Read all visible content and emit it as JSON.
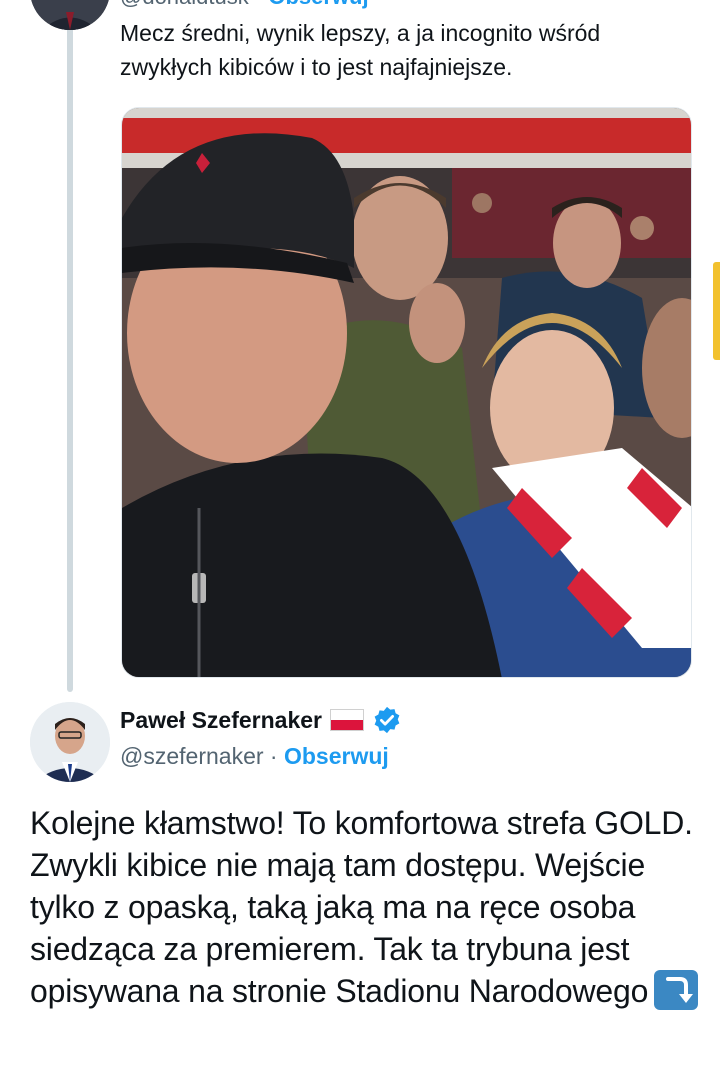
{
  "quoted_tweet": {
    "handle": "@donaldtusk",
    "separator": "·",
    "follow_label": "Obserwuj",
    "text": "Mecz średni, wynik lepszy, a ja incognito wśród zwykłych kibiców i to jest najfajniejsze."
  },
  "tweet": {
    "author_name": "Paweł Szefernaker",
    "handle": "@szefernaker",
    "separator": "·",
    "follow_label": "Obserwuj",
    "text": "Kolejne kłamstwo! To komfortowa strefa GOLD. Zwykli kibice nie mają tam dostępu. Wejście tylko z opaską, taką jaką ma na ręce osoba siedząca za premierem. Tak ta trybuna jest opisywana na stronie Stadionu Narodowego"
  },
  "colors": {
    "accent": "#1d9bf0",
    "secondary_text": "#536471",
    "scroll_indicator": "#f2c12e"
  }
}
